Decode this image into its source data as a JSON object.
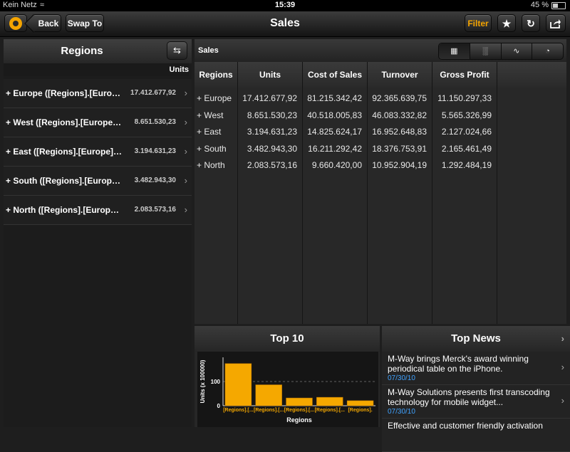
{
  "status_bar": {
    "carrier": "Kein Netz",
    "time": "15:39",
    "battery": "45 %",
    "battery_level": 0.45
  },
  "toolbar": {
    "back_label": "Back",
    "swap_label": "Swap To",
    "title": "Sales",
    "filter_label": "Filter"
  },
  "regions_panel": {
    "title": "Regions",
    "units_label": "Units",
    "items": [
      {
        "label": "+ Europe ([Regions].[Europe])",
        "value": "17.412.677,92"
      },
      {
        "label": "+ West ([Regions].[Europe].[West])",
        "value": "8.651.530,23"
      },
      {
        "label": "+ East ([Regions].[Europe].[East])",
        "value": "3.194.631,23"
      },
      {
        "label": "+ South ([Regions].[Europe].[South])",
        "value": "3.482.943,30"
      },
      {
        "label": "+ North ([Regions].[Europe].[North])",
        "value": "2.083.573,16"
      }
    ]
  },
  "sales_panel": {
    "title": "Sales",
    "columns": [
      "Regions",
      "Units",
      "Cost of Sales",
      "Turnover",
      "Gross Profit"
    ],
    "rows": [
      {
        "region": "+ Europe",
        "units": "17.412.677,92",
        "cost": "81.215.342,42",
        "turnover": "92.365.639,75",
        "profit": "11.150.297,33"
      },
      {
        "region": "+ West",
        "units": "8.651.530,23",
        "cost": "40.518.005,83",
        "turnover": "46.083.332,82",
        "profit": "5.565.326,99"
      },
      {
        "region": "+ East",
        "units": "3.194.631,23",
        "cost": "14.825.624,17",
        "turnover": "16.952.648,83",
        "profit": "2.127.024,66"
      },
      {
        "region": "+ South",
        "units": "3.482.943,30",
        "cost": "16.211.292,42",
        "turnover": "18.376.753,91",
        "profit": "2.165.461,49"
      },
      {
        "region": "+ North",
        "units": "2.083.573,16",
        "cost": "9.660.420,00",
        "turnover": "10.952.904,19",
        "profit": "1.292.484,19"
      }
    ]
  },
  "top10": {
    "title": "Top 10"
  },
  "chart_data": {
    "type": "bar",
    "categories": [
      "[Regions].[...",
      "[Regions].[...",
      "[Regions].[...",
      "[Regions].[...",
      "[Regions]."
    ],
    "values": [
      174.13,
      86.52,
      31.95,
      34.83,
      20.84
    ],
    "xlabel": "Regions",
    "ylabel": "Units (x 100000)",
    "yticks": [
      0,
      100
    ],
    "ylim": [
      0,
      200
    ],
    "bar_color": "#f5a800"
  },
  "news_panel": {
    "title": "Top News",
    "items": [
      {
        "headline": "M-Way brings Merck's award winning periodical table on the iPhone.",
        "date": "07/30/10"
      },
      {
        "headline": "M-Way Solutions presents first transcoding technology for mobile widget...",
        "date": "07/30/10"
      },
      {
        "headline": "Effective and customer friendly activation",
        "date": ""
      }
    ]
  }
}
